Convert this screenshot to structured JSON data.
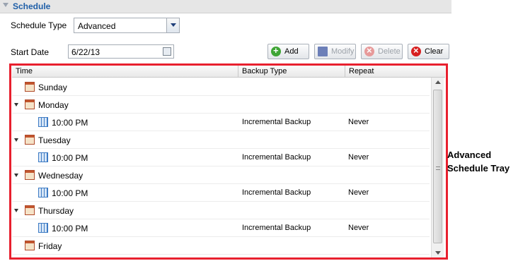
{
  "section": {
    "title": "Schedule"
  },
  "schedule_type": {
    "label": "Schedule Type",
    "value": "Advanced"
  },
  "start_date": {
    "label": "Start Date",
    "value": "6/22/13"
  },
  "toolbar": {
    "add_label": "Add",
    "modify_label": "Modify",
    "delete_label": "Delete",
    "clear_label": "Clear"
  },
  "grid": {
    "columns": [
      "Time",
      "Backup Type",
      "Repeat"
    ],
    "rows": [
      {
        "type": "day",
        "label": "Sunday"
      },
      {
        "type": "day",
        "label": "Monday"
      },
      {
        "type": "time",
        "label": "10:00 PM",
        "backup_type": "Incremental Backup",
        "repeat": "Never"
      },
      {
        "type": "day",
        "label": "Tuesday"
      },
      {
        "type": "time",
        "label": "10:00 PM",
        "backup_type": "Incremental Backup",
        "repeat": "Never"
      },
      {
        "type": "day",
        "label": "Wednesday"
      },
      {
        "type": "time",
        "label": "10:00 PM",
        "backup_type": "Incremental Backup",
        "repeat": "Never"
      },
      {
        "type": "day",
        "label": "Thursday"
      },
      {
        "type": "time",
        "label": "10:00 PM",
        "backup_type": "Incremental Backup",
        "repeat": "Never"
      },
      {
        "type": "day",
        "label": "Friday"
      }
    ]
  },
  "callout": {
    "line1": "Advanced",
    "line2": "Schedule Tray"
  },
  "colors": {
    "highlight_border": "#e8202e",
    "section_title": "#1f5fa8"
  }
}
